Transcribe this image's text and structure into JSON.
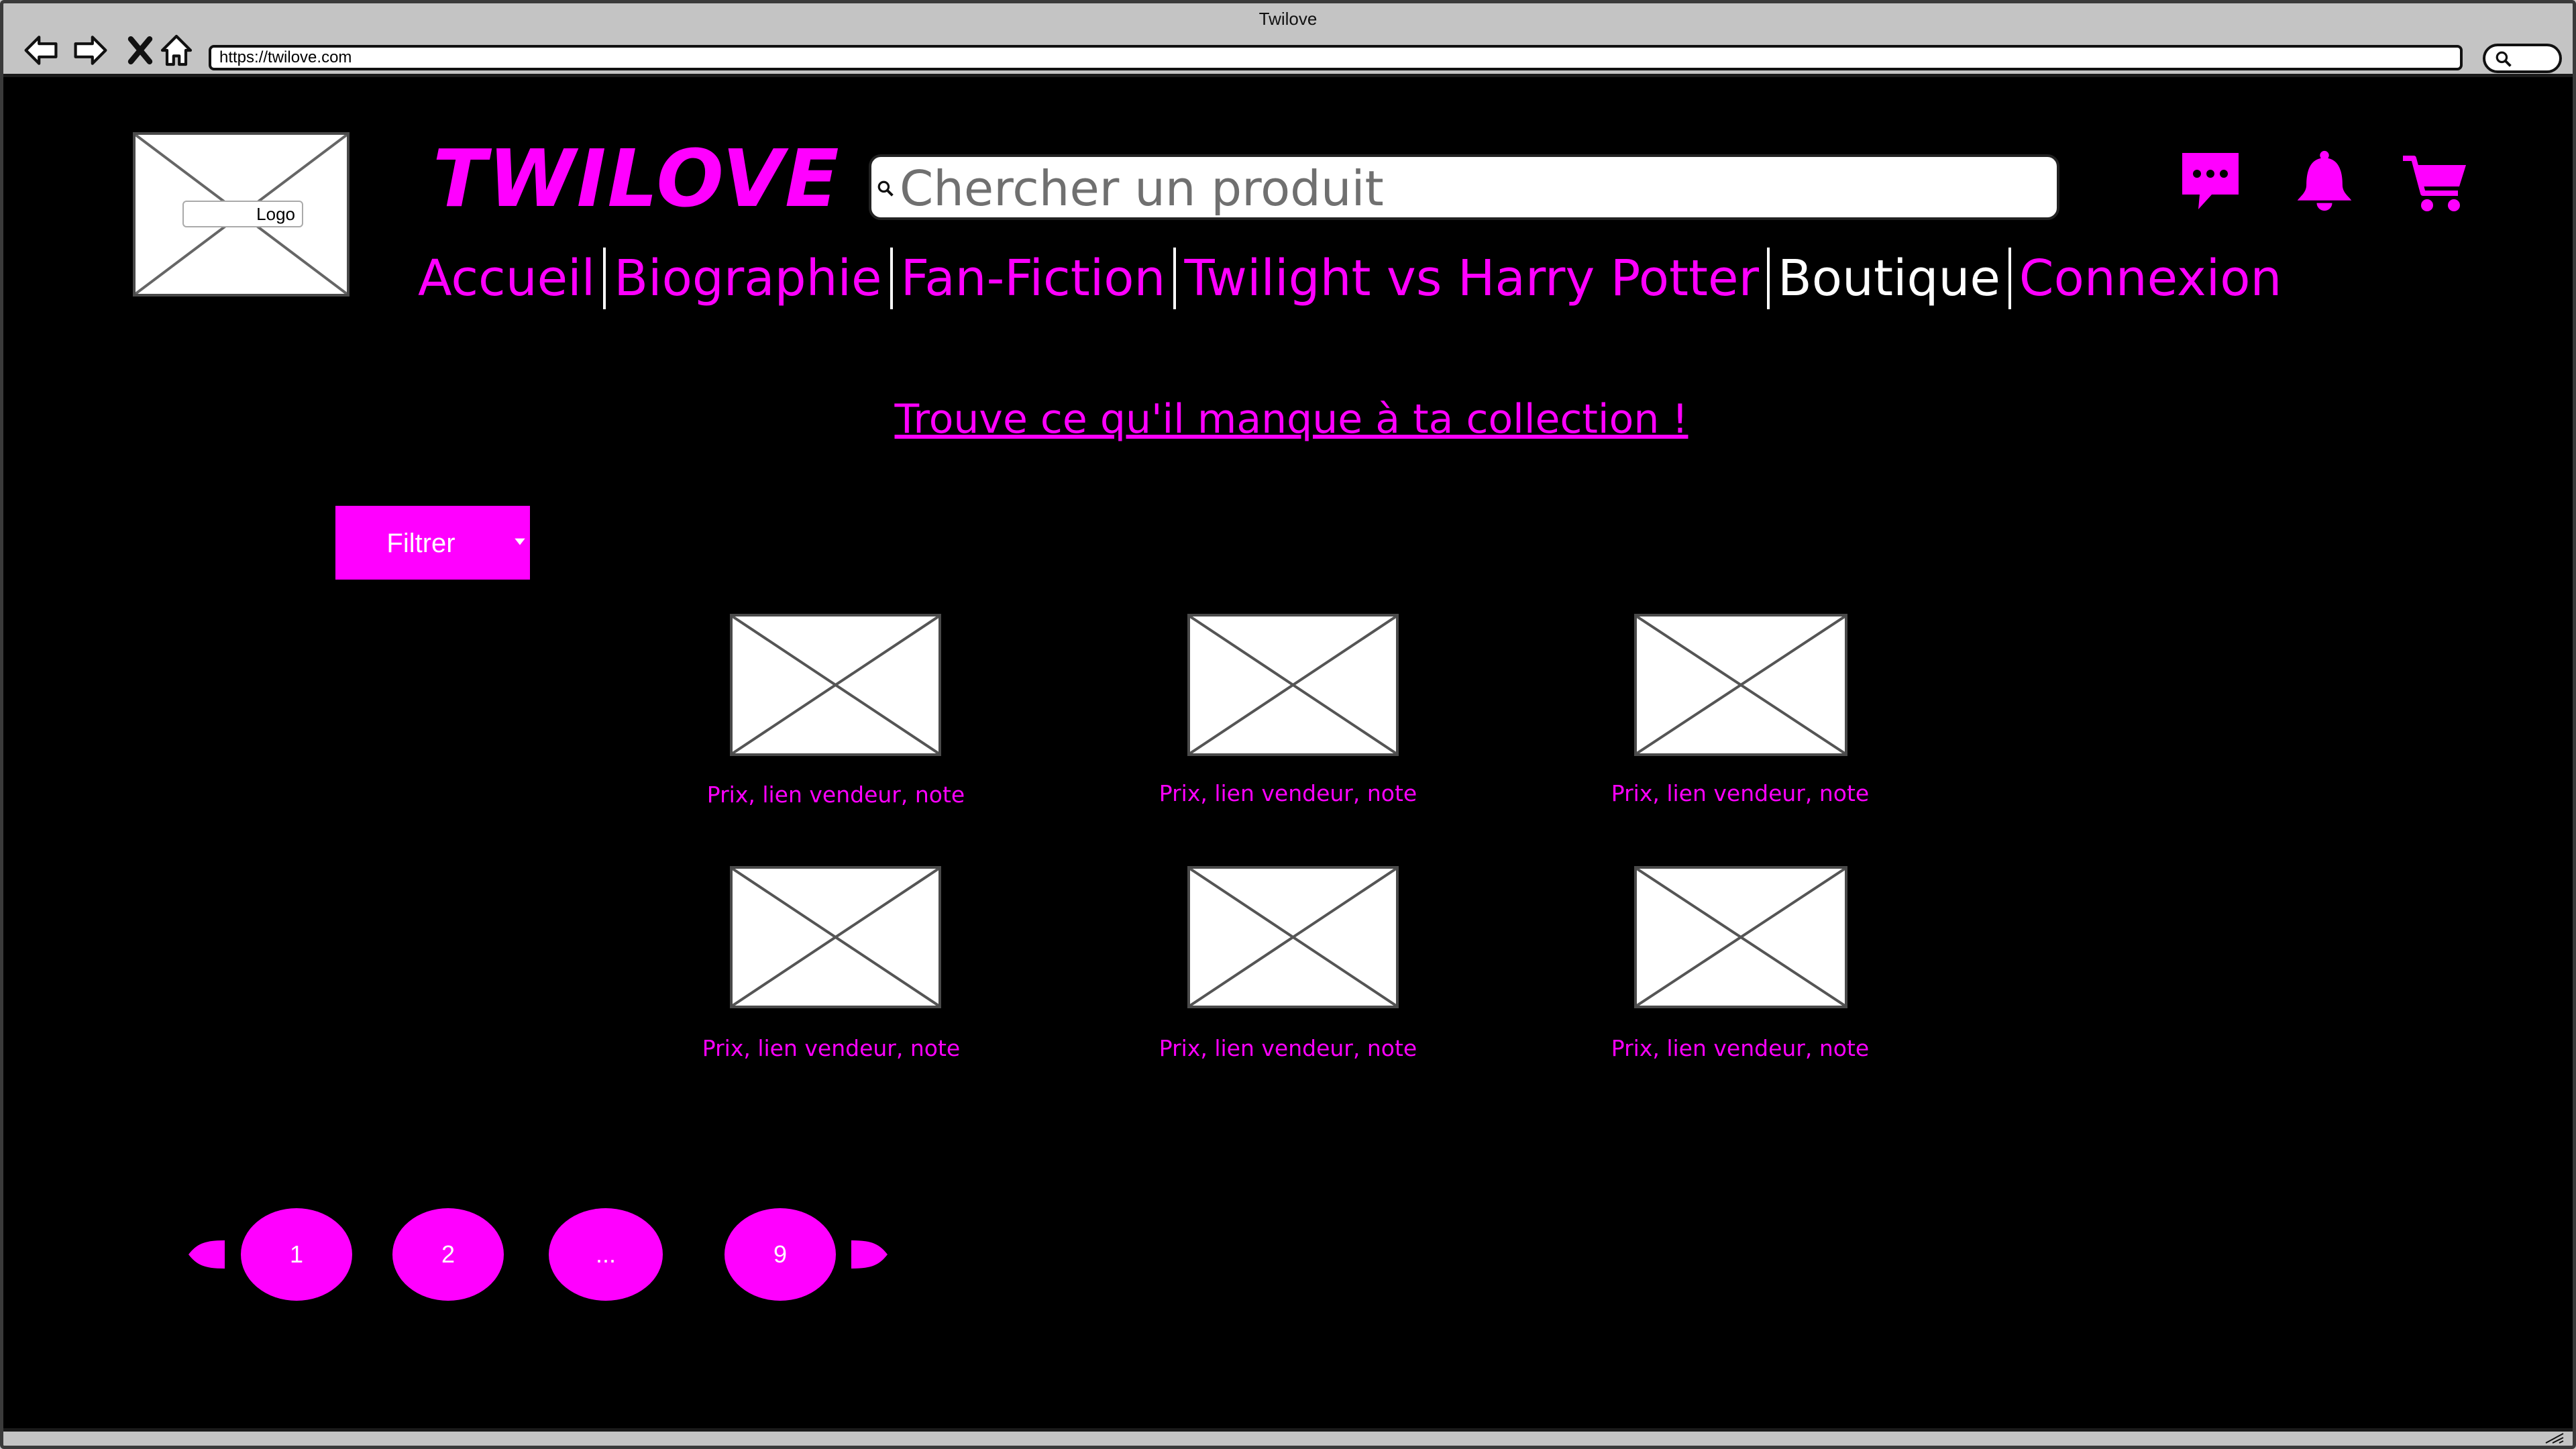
{
  "window": {
    "title": "Twilove",
    "url": "https://twilove.com"
  },
  "site": {
    "logo_label": "Logo",
    "brand": "TWILOVE",
    "search_placeholder": "Chercher un produit",
    "nav": [
      {
        "label": "Accueil",
        "active": false
      },
      {
        "label": "Biographie",
        "active": false
      },
      {
        "label": "Fan-Fiction",
        "active": false
      },
      {
        "label": "Twilight vs Harry Potter",
        "active": false
      },
      {
        "label": "Boutique",
        "active": true
      },
      {
        "label": "Connexion",
        "active": false
      }
    ],
    "header_icons": [
      "chat-icon",
      "bell-icon",
      "cart-icon"
    ],
    "headline": "Trouve ce qu'il manque à ta collection !",
    "filter_label": "Filtrer",
    "products": [
      {
        "caption": "Prix, lien vendeur, note"
      },
      {
        "caption": "Prix, lien vendeur, note"
      },
      {
        "caption": "Prix, lien vendeur, note"
      },
      {
        "caption": "Prix, lien vendeur, note"
      },
      {
        "caption": "Prix, lien vendeur, note"
      },
      {
        "caption": "Prix, lien vendeur, note"
      }
    ],
    "pagination": [
      "1",
      "2",
      "...",
      "9"
    ]
  },
  "colors": {
    "accent": "#ff00ff",
    "background": "#000000",
    "active_nav": "#ffffff"
  }
}
